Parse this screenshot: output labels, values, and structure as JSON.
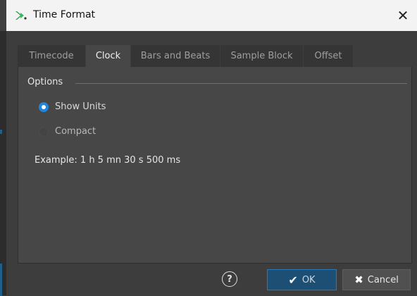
{
  "window": {
    "title": "Time Format",
    "close_icon": "close-icon",
    "app_icon": "wavelab-logo-icon"
  },
  "tabs": [
    {
      "label": "Timecode",
      "active": false
    },
    {
      "label": "Clock",
      "active": true
    },
    {
      "label": "Bars and Beats",
      "active": false
    },
    {
      "label": "Sample Block",
      "active": false
    },
    {
      "label": "Offset",
      "active": false
    }
  ],
  "options": {
    "group_label": "Options",
    "radios": [
      {
        "label": "Show Units",
        "selected": true
      },
      {
        "label": "Compact",
        "selected": false
      }
    ],
    "example": "Example: 1 h 5 mn 30 s 500 ms"
  },
  "footer": {
    "help_symbol": "?",
    "ok_label": "OK",
    "cancel_label": "Cancel"
  },
  "colors": {
    "accent": "#1f86e0",
    "ok_bg": "#1d4e73",
    "bg": "#3d3d3d"
  }
}
